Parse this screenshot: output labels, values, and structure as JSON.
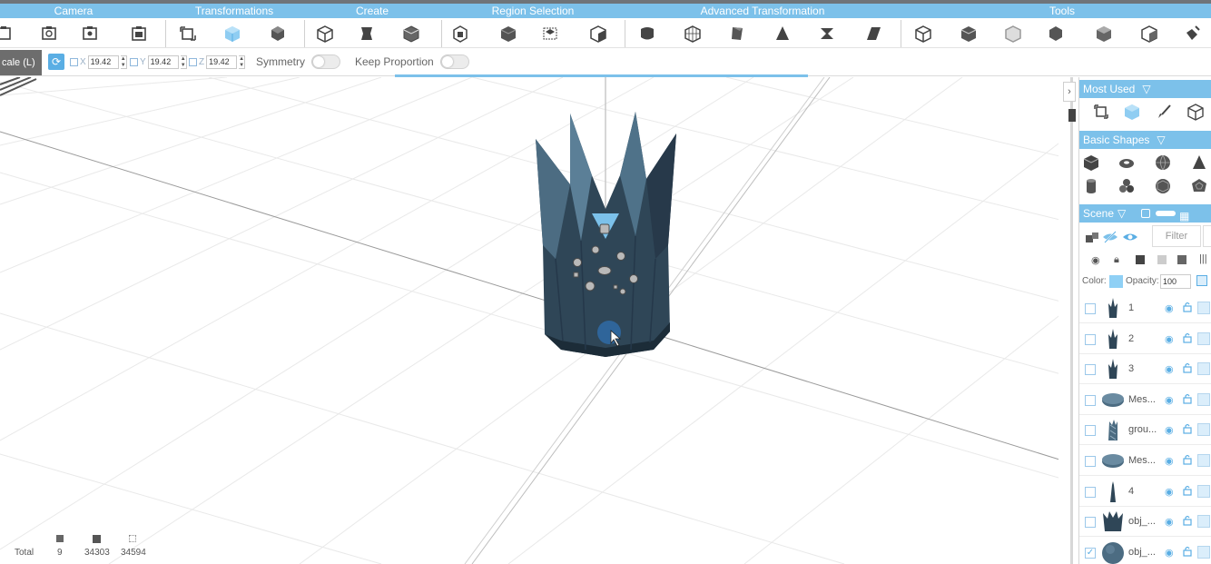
{
  "categories": [
    "Camera",
    "Transformations",
    "Create",
    "Region Selection",
    "Advanced Transformation",
    "Tools"
  ],
  "options": {
    "scale_tab": "cale (L)",
    "x_label": "X",
    "x_value": "19.42",
    "y_label": "Y",
    "y_value": "19.42",
    "z_label": "Z",
    "z_value": "19.42",
    "symmetry_label": "Symmetry",
    "keep_proportion_label": "Keep Proportion"
  },
  "stats": {
    "total_label": "Total",
    "objects": "9",
    "vertices": "34303",
    "faces": "34594"
  },
  "panel": {
    "most_used": "Most Used",
    "basic_shapes": "Basic Shapes",
    "scene": "Scene",
    "filter_placeholder": "Filter",
    "color_label": "Color:",
    "opacity_label": "Opacity:",
    "opacity_value": "100"
  },
  "layers": [
    {
      "name": "1",
      "checked": false,
      "thumb": "crown"
    },
    {
      "name": "2",
      "checked": false,
      "thumb": "crown"
    },
    {
      "name": "3",
      "checked": false,
      "thumb": "crown"
    },
    {
      "name": "Mes...",
      "checked": false,
      "thumb": "disc"
    },
    {
      "name": "grou...",
      "checked": false,
      "thumb": "group"
    },
    {
      "name": "Mes...",
      "checked": false,
      "thumb": "disc"
    },
    {
      "name": "4",
      "checked": false,
      "thumb": "spike"
    },
    {
      "name": "obj_...",
      "checked": false,
      "thumb": "crown-wide"
    },
    {
      "name": "obj_...",
      "checked": true,
      "thumb": "ball"
    }
  ],
  "colors": {
    "accent": "#7cc1ea",
    "object": "#2f4657",
    "swatch": "#8fd0f5"
  }
}
